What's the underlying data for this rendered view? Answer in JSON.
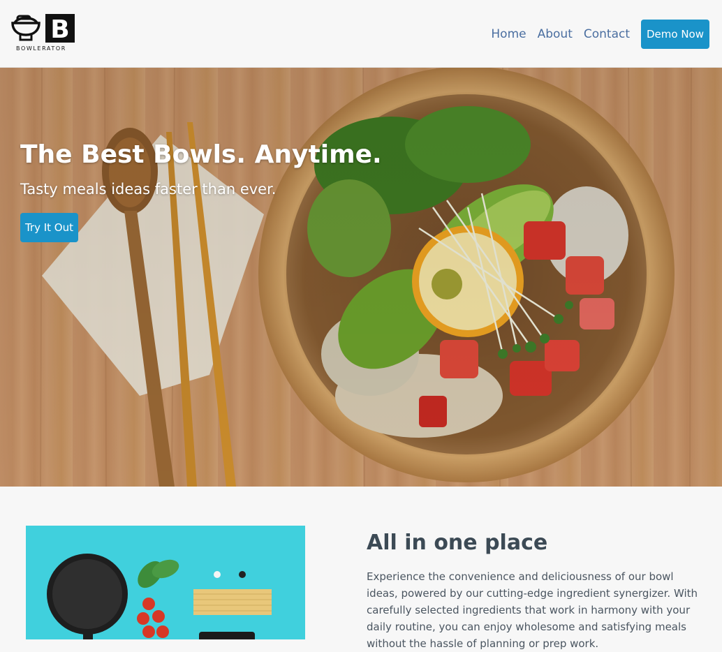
{
  "brand": {
    "name": "BOWLERATOR",
    "icon": "bowl-icon",
    "logo_letter": "B"
  },
  "nav": {
    "links": [
      {
        "label": "Home"
      },
      {
        "label": "About"
      },
      {
        "label": "Contact"
      }
    ],
    "cta_label": "Demo Now"
  },
  "hero": {
    "title": "The Best Bowls. Anytime.",
    "subtitle": "Tasty meals ideas faster than ever.",
    "button_label": "Try It Out"
  },
  "feature": {
    "title": "All in one place",
    "body": "Experience the convenience and deliciousness of our bowl ideas, powered by our cutting-edge ingredient synergizer. With carefully selected ingredients that work in harmony with your daily routine, you can enjoy wholesome and satisfying meals without the hassle of planning or prep work."
  },
  "colors": {
    "accent": "#1a93c9",
    "nav_link": "#4a6ea0",
    "background": "#f7f7f7",
    "heading": "#3c4a55"
  }
}
